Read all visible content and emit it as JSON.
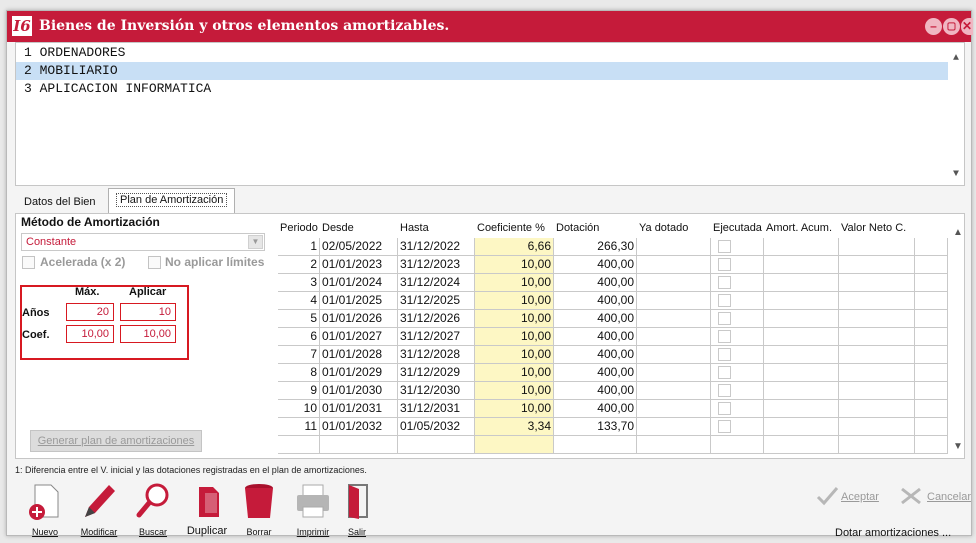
{
  "window": {
    "title": "Bienes de Inversión y otros elementos amortizables.",
    "logo": "I6"
  },
  "window_buttons": {
    "minimize": "–",
    "restore": "▢",
    "close": "✕"
  },
  "list": {
    "items": [
      {
        "label": "1 ORDENADORES"
      },
      {
        "label": "2 MOBILIARIO"
      },
      {
        "label": "3 APLICACION INFORMATICA"
      }
    ]
  },
  "tabs": {
    "datos": "Datos del Bien",
    "plan": "Plan de Amortización"
  },
  "method": {
    "label": "Método de Amortización",
    "value": "Constante",
    "acelerada": "Acelerada (x 2)",
    "no_limites": "No aplicar límites"
  },
  "limits": {
    "max_label": "Máx.",
    "aplicar_label": "Aplicar",
    "anos_label": "Años",
    "coef_label": "Coef.",
    "anos_max": "20",
    "anos_aplicar": "10",
    "coef_max": "10,00",
    "coef_aplicar": "10,00"
  },
  "generar_button": "Generar plan de amortizaciones",
  "grid": {
    "headers": [
      "Periodo",
      "Desde",
      "Hasta",
      "Coeficiente %",
      "Dotación",
      "Ya dotado",
      "Ejecutada",
      "Amort. Acum.",
      "Valor Neto C."
    ],
    "rows": [
      {
        "periodo": "1",
        "desde": "02/05/2022",
        "hasta": "31/12/2022",
        "coef": "6,66",
        "dotacion": "266,30"
      },
      {
        "periodo": "2",
        "desde": "01/01/2023",
        "hasta": "31/12/2023",
        "coef": "10,00",
        "dotacion": "400,00"
      },
      {
        "periodo": "3",
        "desde": "01/01/2024",
        "hasta": "31/12/2024",
        "coef": "10,00",
        "dotacion": "400,00"
      },
      {
        "periodo": "4",
        "desde": "01/01/2025",
        "hasta": "31/12/2025",
        "coef": "10,00",
        "dotacion": "400,00"
      },
      {
        "periodo": "5",
        "desde": "01/01/2026",
        "hasta": "31/12/2026",
        "coef": "10,00",
        "dotacion": "400,00"
      },
      {
        "periodo": "6",
        "desde": "01/01/2027",
        "hasta": "31/12/2027",
        "coef": "10,00",
        "dotacion": "400,00"
      },
      {
        "periodo": "7",
        "desde": "01/01/2028",
        "hasta": "31/12/2028",
        "coef": "10,00",
        "dotacion": "400,00"
      },
      {
        "periodo": "8",
        "desde": "01/01/2029",
        "hasta": "31/12/2029",
        "coef": "10,00",
        "dotacion": "400,00"
      },
      {
        "periodo": "9",
        "desde": "01/01/2030",
        "hasta": "31/12/2030",
        "coef": "10,00",
        "dotacion": "400,00"
      },
      {
        "periodo": "10",
        "desde": "01/01/2031",
        "hasta": "31/12/2031",
        "coef": "10,00",
        "dotacion": "400,00"
      },
      {
        "periodo": "11",
        "desde": "01/01/2032",
        "hasta": "01/05/2032",
        "coef": "3,34",
        "dotacion": "133,70"
      }
    ]
  },
  "footnote": "1: Diferencia entre el V. inicial y las dotaciones registradas en el plan de amortizaciones.",
  "toolbar": {
    "nuevo": "Nuevo",
    "modificar": "Modificar",
    "buscar": "Buscar",
    "duplicar": "Duplicar",
    "borrar": "Borrar",
    "imprimir": "Imprimir",
    "salir": "Salir"
  },
  "actions": {
    "aceptar": "Aceptar",
    "cancelar": "Cancelar",
    "dotar": "Dotar amortizaciones ..."
  },
  "colors": {
    "accent": "#c51b3a",
    "selection": "#c8dff5",
    "highlight_col": "#fdf7c4",
    "limits_border": "#d71921"
  }
}
